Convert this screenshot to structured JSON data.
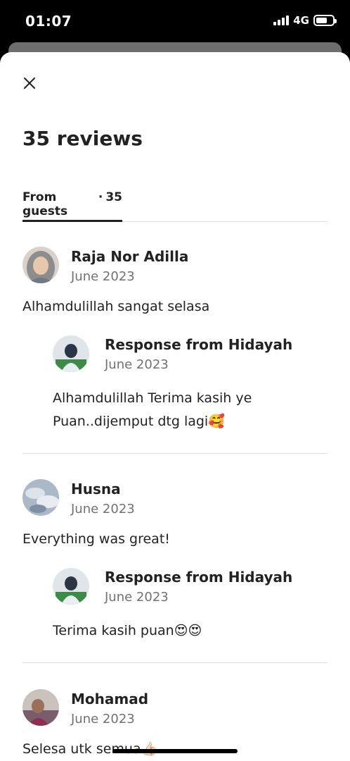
{
  "status_bar": {
    "time": "01:07",
    "network": "4G"
  },
  "sheet": {
    "title": "35 reviews",
    "tab": {
      "label": "From guests",
      "separator": "·",
      "count": "35"
    }
  },
  "reviews": [
    {
      "name": "Raja Nor Adilla",
      "date": "June 2023",
      "text": "Alhamdulillah sangat selasa",
      "response": {
        "title": "Response from Hidayah",
        "date": "June 2023",
        "text": "Alhamdulillah Terima kasih ye Puan..dijemput dtg lagi🥰"
      }
    },
    {
      "name": "Husna",
      "date": "June 2023",
      "text": "Everything was great!",
      "response": {
        "title": "Response from Hidayah",
        "date": "June 2023",
        "text": "Terima kasih puan😍😍"
      }
    },
    {
      "name": "Mohamad",
      "date": "June 2023",
      "text": "Selesa utk semua👍🏻"
    }
  ],
  "colors": {
    "text": "#222222",
    "muted": "#717171",
    "divider": "#dddddd"
  }
}
